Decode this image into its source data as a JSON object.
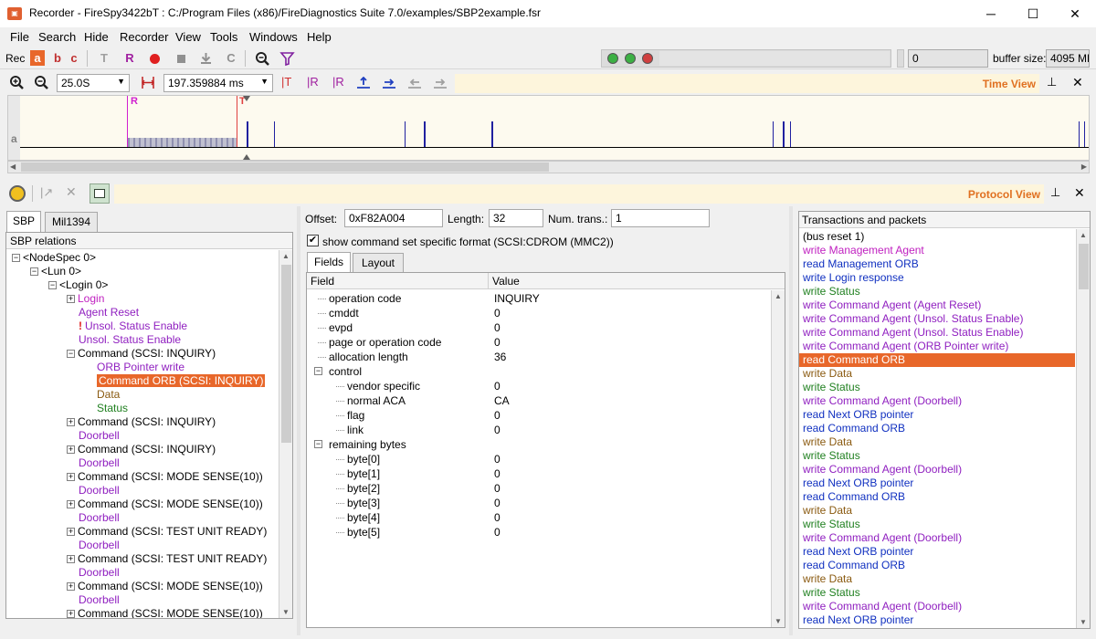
{
  "window": {
    "title": "Recorder - FireSpy3422bT : C:/Program Files (x86)/FireDiagnostics Suite 7.0/examples/SBP2example.fsr",
    "minimize": "─",
    "maximize": "☐",
    "close": "✕"
  },
  "menu": [
    "File",
    "Search",
    "Hide",
    "Recorder",
    "View",
    "Tools",
    "Windows",
    "Help"
  ],
  "toolbar": {
    "rec_label": "Rec",
    "a": "a",
    "b": "b",
    "c": "c",
    "t": "T",
    "r": "R",
    "cc": "C",
    "counter_value": "0",
    "buffer_label": "buffer size:",
    "buffer_value": "4095 MB",
    "led_colors": [
      "#3cb044",
      "#3cb044",
      "#d04040"
    ]
  },
  "timeview": {
    "zoom_value": "25.0S",
    "duration_value": "197.359884 ms",
    "label": "Time View",
    "track_label": "a",
    "marker_r": "R",
    "marker_t": "T"
  },
  "protocolview": {
    "label": "Protocol View"
  },
  "left": {
    "tabs": [
      "SBP",
      "Mil1394"
    ],
    "header": "SBP relations",
    "tree": [
      {
        "label": "<NodeSpec 0>",
        "indent": 0,
        "exp": "−",
        "color": "#000"
      },
      {
        "label": "<Lun 0>",
        "indent": 1,
        "exp": "−",
        "color": "#000"
      },
      {
        "label": "<Login 0>",
        "indent": 2,
        "exp": "−",
        "color": "#000"
      },
      {
        "label": "Login",
        "indent": 3,
        "exp": "+",
        "color": "#c020c0"
      },
      {
        "label": "Agent Reset",
        "indent": 3,
        "exp": "",
        "color": "#9020c0"
      },
      {
        "label": "Unsol. Status Enable",
        "indent": 3,
        "exp": "",
        "color": "#9020c0",
        "warn": "!"
      },
      {
        "label": "Unsol. Status Enable",
        "indent": 3,
        "exp": "",
        "color": "#9020c0"
      },
      {
        "label": "Command (SCSI: INQUIRY)",
        "indent": 3,
        "exp": "−",
        "color": "#000"
      },
      {
        "label": "ORB Pointer write",
        "indent": 4,
        "exp": "",
        "color": "#9020c0"
      },
      {
        "label": "Command ORB (SCSI: INQUIRY)",
        "indent": 4,
        "exp": "",
        "color": "#fff",
        "sel": true
      },
      {
        "label": "Data",
        "indent": 4,
        "exp": "",
        "color": "#8a5a10"
      },
      {
        "label": "Status",
        "indent": 4,
        "exp": "",
        "color": "#208020"
      },
      {
        "label": "Command (SCSI: INQUIRY)",
        "indent": 3,
        "exp": "+",
        "color": "#000"
      },
      {
        "label": "Doorbell",
        "indent": 3,
        "exp": "",
        "color": "#9020c0"
      },
      {
        "label": "Command (SCSI: INQUIRY)",
        "indent": 3,
        "exp": "+",
        "color": "#000"
      },
      {
        "label": "Doorbell",
        "indent": 3,
        "exp": "",
        "color": "#9020c0"
      },
      {
        "label": "Command (SCSI: MODE SENSE(10))",
        "indent": 3,
        "exp": "+",
        "color": "#000"
      },
      {
        "label": "Doorbell",
        "indent": 3,
        "exp": "",
        "color": "#9020c0"
      },
      {
        "label": "Command (SCSI: MODE SENSE(10))",
        "indent": 3,
        "exp": "+",
        "color": "#000"
      },
      {
        "label": "Doorbell",
        "indent": 3,
        "exp": "",
        "color": "#9020c0"
      },
      {
        "label": "Command (SCSI: TEST UNIT READY)",
        "indent": 3,
        "exp": "+",
        "color": "#000"
      },
      {
        "label": "Doorbell",
        "indent": 3,
        "exp": "",
        "color": "#9020c0"
      },
      {
        "label": "Command (SCSI: TEST UNIT READY)",
        "indent": 3,
        "exp": "+",
        "color": "#000"
      },
      {
        "label": "Doorbell",
        "indent": 3,
        "exp": "",
        "color": "#9020c0"
      },
      {
        "label": "Command (SCSI: MODE SENSE(10))",
        "indent": 3,
        "exp": "+",
        "color": "#000"
      },
      {
        "label": "Doorbell",
        "indent": 3,
        "exp": "",
        "color": "#9020c0"
      },
      {
        "label": "Command (SCSI: MODE SENSE(10))",
        "indent": 3,
        "exp": "+",
        "color": "#000"
      }
    ]
  },
  "middle": {
    "offset_label": "Offset:",
    "offset_value": "0xF82A004",
    "length_label": "Length:",
    "length_value": "32",
    "numtrans_label": "Num. trans.:",
    "numtrans_value": "1",
    "checkbox_label": "show command set specific format (SCSI:CDROM (MMC2))",
    "tabs": [
      "Fields",
      "Layout"
    ],
    "col_field": "Field",
    "col_value": "Value",
    "rows": [
      {
        "field": "operation code",
        "value": "INQUIRY",
        "indent": 1
      },
      {
        "field": "cmddt",
        "value": "0",
        "indent": 1
      },
      {
        "field": "evpd",
        "value": "0",
        "indent": 1
      },
      {
        "field": "page or operation code",
        "value": "0",
        "indent": 1
      },
      {
        "field": "allocation length",
        "value": "36",
        "indent": 1
      },
      {
        "field": "control",
        "value": "",
        "indent": 1,
        "exp": "−"
      },
      {
        "field": "vendor specific",
        "value": "0",
        "indent": 2
      },
      {
        "field": "normal ACA",
        "value": "CA",
        "indent": 2
      },
      {
        "field": "flag",
        "value": "0",
        "indent": 2
      },
      {
        "field": "link",
        "value": "0",
        "indent": 2
      },
      {
        "field": "remaining bytes",
        "value": "",
        "indent": 1,
        "exp": "−"
      },
      {
        "field": "byte[0]",
        "value": "0",
        "indent": 2
      },
      {
        "field": "byte[1]",
        "value": "0",
        "indent": 2
      },
      {
        "field": "byte[2]",
        "value": "0",
        "indent": 2
      },
      {
        "field": "byte[3]",
        "value": "0",
        "indent": 2
      },
      {
        "field": "byte[4]",
        "value": "0",
        "indent": 2
      },
      {
        "field": "byte[5]",
        "value": "0",
        "indent": 2
      }
    ]
  },
  "right": {
    "header": "Transactions and packets",
    "rows": [
      {
        "label": "(bus reset 1)",
        "color": "#000"
      },
      {
        "label": "write Management Agent",
        "color": "#c020c0"
      },
      {
        "label": "read Management ORB",
        "color": "#1030c0"
      },
      {
        "label": "write Login response",
        "color": "#1030c0"
      },
      {
        "label": "write Status",
        "color": "#208020"
      },
      {
        "label": "write Command Agent (Agent Reset)",
        "color": "#9020c0"
      },
      {
        "label": "write Command Agent (Unsol. Status Enable)",
        "color": "#9020c0"
      },
      {
        "label": "write Command Agent (Unsol. Status Enable)",
        "color": "#9020c0"
      },
      {
        "label": "write Command Agent (ORB Pointer write)",
        "color": "#9020c0"
      },
      {
        "label": "read Command ORB",
        "color": "#fff",
        "sel": true
      },
      {
        "label": "write Data",
        "color": "#8a5a10"
      },
      {
        "label": "write Status",
        "color": "#208020"
      },
      {
        "label": "write Command Agent (Doorbell)",
        "color": "#9020c0"
      },
      {
        "label": "read Next ORB pointer",
        "color": "#1030c0"
      },
      {
        "label": "read Command ORB",
        "color": "#1030c0"
      },
      {
        "label": "write Data",
        "color": "#8a5a10"
      },
      {
        "label": "write Status",
        "color": "#208020"
      },
      {
        "label": "write Command Agent (Doorbell)",
        "color": "#9020c0"
      },
      {
        "label": "read Next ORB pointer",
        "color": "#1030c0"
      },
      {
        "label": "read Command ORB",
        "color": "#1030c0"
      },
      {
        "label": "write Data",
        "color": "#8a5a10"
      },
      {
        "label": "write Status",
        "color": "#208020"
      },
      {
        "label": "write Command Agent (Doorbell)",
        "color": "#9020c0"
      },
      {
        "label": "read Next ORB pointer",
        "color": "#1030c0"
      },
      {
        "label": "read Command ORB",
        "color": "#1030c0"
      },
      {
        "label": "write Data",
        "color": "#8a5a10"
      },
      {
        "label": "write Status",
        "color": "#208020"
      },
      {
        "label": "write Command Agent (Doorbell)",
        "color": "#9020c0"
      },
      {
        "label": "read Next ORB pointer",
        "color": "#1030c0"
      },
      {
        "label": "read Command ORB",
        "color": "#1030c0"
      }
    ]
  }
}
